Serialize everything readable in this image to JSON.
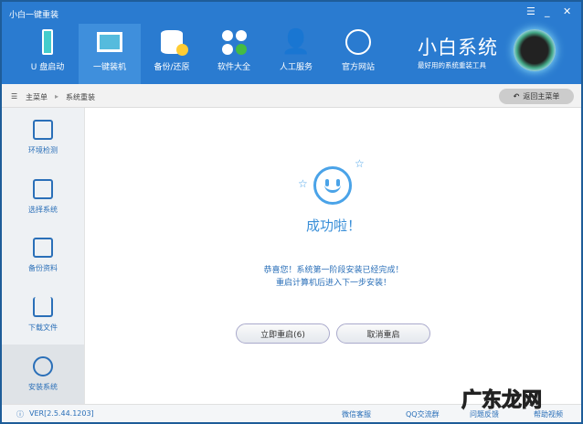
{
  "window": {
    "title": "小白一键重装",
    "menu": "☰",
    "minimize": "_",
    "close": "✕"
  },
  "nav": [
    {
      "label": "U 盘启动",
      "icon": "usb-icon"
    },
    {
      "label": "一键装机",
      "icon": "monitor-windows-icon",
      "active": true
    },
    {
      "label": "备份/还原",
      "icon": "database-icon"
    },
    {
      "label": "软件大全",
      "icon": "apps-icon"
    },
    {
      "label": "人工服务",
      "icon": "person-heart-icon"
    },
    {
      "label": "官方网站",
      "icon": "globe-icon"
    }
  ],
  "brand": {
    "name": "小白系统",
    "slogan": "最好用的系统重装工具"
  },
  "breadcrumb": {
    "root": "主菜单",
    "current": "系统重装",
    "back": "返回主菜单"
  },
  "sidebar": [
    {
      "label": "环境检测"
    },
    {
      "label": "选择系统"
    },
    {
      "label": "备份资料"
    },
    {
      "label": "下载文件"
    },
    {
      "label": "安装系统",
      "active": true
    }
  ],
  "main": {
    "success": "成功啦！",
    "line1": "恭喜您！系统第一阶段安装已经完成！",
    "line2": "重启计算机后进入下一步安装！",
    "restart": "立即重启(6)",
    "cancel": "取消重启"
  },
  "footer": {
    "version": "VER[2.5.44.1203]",
    "wechat": "微信客服",
    "qq": "QQ交流群",
    "feedback": "问题反馈",
    "help": "帮助视频"
  },
  "watermark": "广东龙网"
}
